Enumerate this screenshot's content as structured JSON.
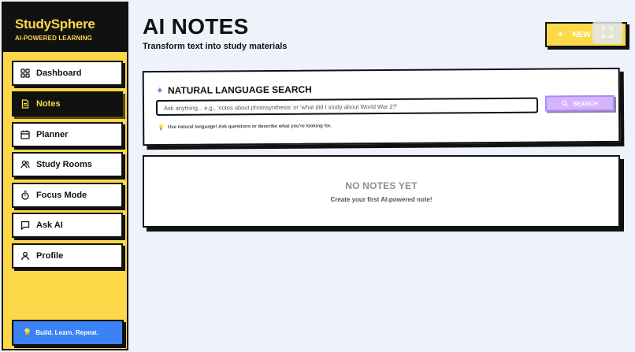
{
  "brand": {
    "name": "StudySphere",
    "tagline": "AI-POWERED LEARNING"
  },
  "sidebar": {
    "items": [
      {
        "label": "Dashboard",
        "icon": "grid-icon",
        "active": false
      },
      {
        "label": "Notes",
        "icon": "document-icon",
        "active": true
      },
      {
        "label": "Planner",
        "icon": "calendar-icon",
        "active": false
      },
      {
        "label": "Study Rooms",
        "icon": "users-icon",
        "active": false
      },
      {
        "label": "Focus Mode",
        "icon": "timer-icon",
        "active": false
      },
      {
        "label": "Ask AI",
        "icon": "chat-icon",
        "active": false
      },
      {
        "label": "Profile",
        "icon": "user-icon",
        "active": false
      }
    ],
    "motto": "Build. Learn. Repeat."
  },
  "header": {
    "title": "AI NOTES",
    "subtitle": "Transform text into study materials",
    "new_button_label": "NEW"
  },
  "search": {
    "heading": "NATURAL LANGUAGE SEARCH",
    "placeholder": "Ask anything... e.g., 'notes about photosynthesis' or 'what did I study about World War 2?'",
    "button_label": "SEARCH",
    "hint": "Use natural language! Ask questions or describe what you're looking for."
  },
  "empty_state": {
    "title": "NO NOTES YET",
    "subtitle": "Create your first AI-powered note!"
  },
  "colors": {
    "sidebar_bg": "#fdd94a",
    "brand_bg": "#111111",
    "accent_blue": "#3b82f6",
    "search_button": "#d8b4fe",
    "page_bg": "#eef3fb"
  }
}
